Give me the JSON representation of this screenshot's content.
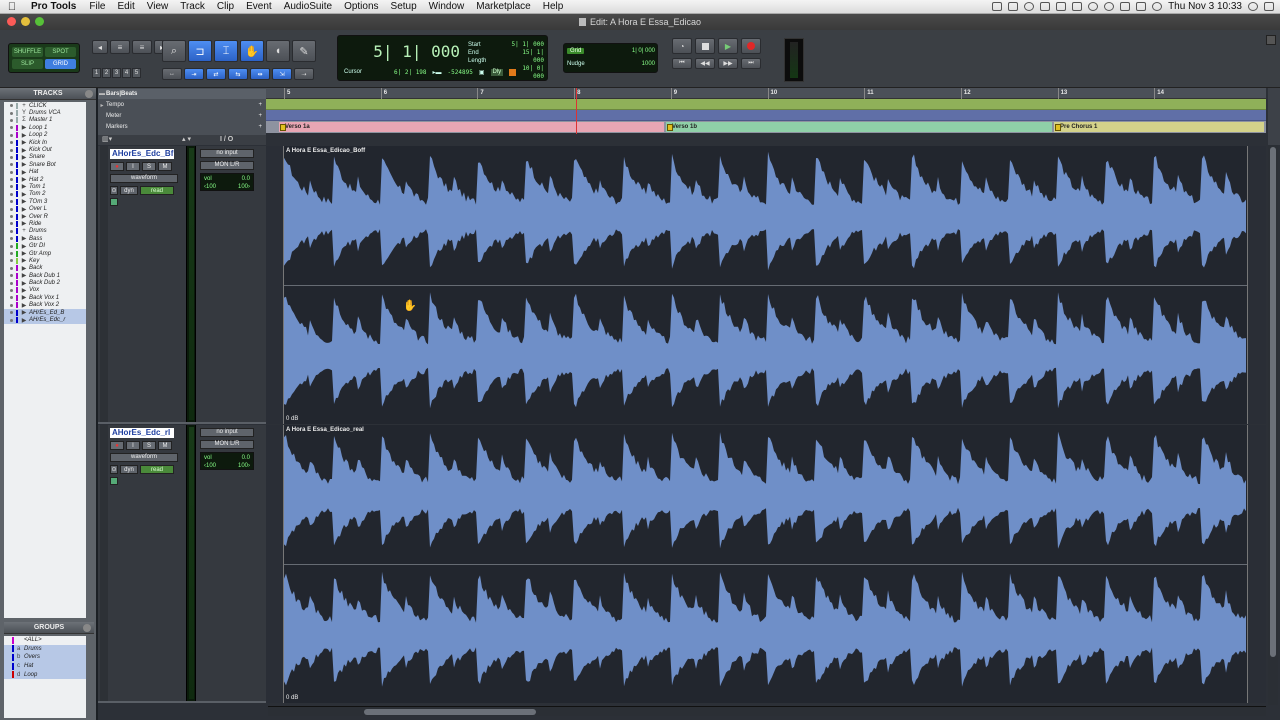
{
  "menubar": {
    "apple": "",
    "app_name": "Pro Tools",
    "items": [
      "File",
      "Edit",
      "View",
      "Track",
      "Clip",
      "Event",
      "AudioSuite",
      "Options",
      "Setup",
      "Window",
      "Marketplace",
      "Help"
    ],
    "clock": "Thu Nov 3  10:33"
  },
  "window": {
    "title": "Edit: A Hora E Essa_Edicao"
  },
  "toolbar": {
    "modes": [
      "SHUFFLE",
      "SPOT",
      "SLIP",
      "GRID"
    ],
    "zoom_presets": [
      "1",
      "2",
      "3",
      "4",
      "5"
    ],
    "main_counter": "5| 1| 000",
    "sel_labels": [
      "Start",
      "End",
      "Length"
    ],
    "sel_values": [
      "5| 1| 000",
      "15| 1| 000",
      "10| 0| 000"
    ],
    "cursor_label": "Cursor",
    "cursor_value": "6| 2| 198",
    "cursor_sample": "-524895",
    "dly_label": "Dly",
    "grid_badge": "Grid",
    "grid_value": "1| 0| 000",
    "nudge_label": "Nudge",
    "nudge_value": "1000"
  },
  "tracks_panel": {
    "title": "TRACKS",
    "items": [
      {
        "name": "CLICK",
        "glyph": "+",
        "color": "#9aa"
      },
      {
        "name": "Drums VCA",
        "glyph": "Y",
        "color": "#9aa"
      },
      {
        "name": "Master 1",
        "glyph": "Σ",
        "color": "#9aa"
      },
      {
        "name": "Loop 1",
        "glyph": "▶",
        "color": "#a0c"
      },
      {
        "name": "Loop 2",
        "glyph": "▶",
        "color": "#a0c"
      },
      {
        "name": "Kick In",
        "glyph": "▶",
        "color": "#00c"
      },
      {
        "name": "Kick Out",
        "glyph": "▶",
        "color": "#00c"
      },
      {
        "name": "Snare",
        "glyph": "▶",
        "color": "#00c"
      },
      {
        "name": "Snare Bot",
        "glyph": "▶",
        "color": "#00c"
      },
      {
        "name": "Hat",
        "glyph": "▶",
        "color": "#00c"
      },
      {
        "name": "Hat 2",
        "glyph": "▶",
        "color": "#00c"
      },
      {
        "name": "Tom 1",
        "glyph": "▶",
        "color": "#00c"
      },
      {
        "name": "Tom 2",
        "glyph": "▶",
        "color": "#00c"
      },
      {
        "name": "TOm 3",
        "glyph": "▶",
        "color": "#00c"
      },
      {
        "name": "Over L",
        "glyph": "▶",
        "color": "#00c"
      },
      {
        "name": "Over R",
        "glyph": "▶",
        "color": "#00c"
      },
      {
        "name": "Ride",
        "glyph": "▶",
        "color": "#00c"
      },
      {
        "name": "Drums",
        "glyph": "+",
        "color": "#00c"
      },
      {
        "name": "Bass",
        "glyph": "▶",
        "color": "#00c"
      },
      {
        "name": "Gtr DI",
        "glyph": "▶",
        "color": "#2a2"
      },
      {
        "name": "Gtr Amp",
        "glyph": "▶",
        "color": "#2a2"
      },
      {
        "name": "Key",
        "glyph": "▶",
        "color": "#8c4"
      },
      {
        "name": "Back",
        "glyph": "▶",
        "color": "#a0c"
      },
      {
        "name": "Back Dub 1",
        "glyph": "▶",
        "color": "#a0c"
      },
      {
        "name": "Back Dub 2",
        "glyph": "▶",
        "color": "#a0c"
      },
      {
        "name": "Vox",
        "glyph": "▶",
        "color": "#a0c"
      },
      {
        "name": "Back Vox 1",
        "glyph": "▶",
        "color": "#a0c"
      },
      {
        "name": "Back Vox 2",
        "glyph": "▶",
        "color": "#a0c"
      },
      {
        "name": "AHrEs_Ed_B",
        "glyph": "▶",
        "color": "#00c",
        "selected": true
      },
      {
        "name": "AHrEs_Edc_r",
        "glyph": "▶",
        "color": "#00c",
        "selected": true
      }
    ]
  },
  "groups_panel": {
    "title": "GROUPS",
    "items": [
      {
        "letter": "",
        "name": "<ALL>",
        "color": "#c0c"
      },
      {
        "letter": "a",
        "name": "Drums",
        "color": "#00c"
      },
      {
        "letter": "b",
        "name": "Overs",
        "color": "#00c"
      },
      {
        "letter": "c",
        "name": "Hat",
        "color": "#00c"
      },
      {
        "letter": "d",
        "name": "Loop",
        "color": "#c00"
      }
    ]
  },
  "rulers": {
    "labels": [
      "Bars|Beats",
      "Tempo",
      "Meter",
      "Markers"
    ],
    "bars": [
      "5",
      "6",
      "7",
      "8",
      "9",
      "10",
      "11",
      "12",
      "13",
      "14"
    ],
    "markers": [
      {
        "name": "Verso 1a",
        "color": "#e8a6b4"
      },
      {
        "name": "Verso 1b",
        "color": "#8fd0a8"
      },
      {
        "name": "Pre Chorus 1",
        "color": "#d4d28a"
      }
    ]
  },
  "columns": {
    "io": "I / O"
  },
  "tracks": [
    {
      "name": "AHorEs_Edc_Bf",
      "input": "no input",
      "output": "MON L/R",
      "view": "waveform",
      "dyn": "dyn",
      "auto": "read",
      "vol_label": "vol",
      "vol_value": "0.0",
      "pan_l": "‹100",
      "pan_r": "100›",
      "clip_name": "A Hora E Essa_Edicao_Boff",
      "clip_db": "0 dB"
    },
    {
      "name": "AHorEs_Edc_rl",
      "input": "no input",
      "output": "MON L/R",
      "view": "waveform",
      "dyn": "dyn",
      "auto": "read",
      "vol_label": "vol",
      "vol_value": "0.0",
      "pan_l": "‹100",
      "pan_r": "100›",
      "clip_name": "A Hora E Essa_Edicao_real",
      "clip_db": "0 dB"
    }
  ],
  "colors": {
    "waveform": "#6f8fc8",
    "selection": "#b7c8e6",
    "accent": "#3f7ee0"
  }
}
